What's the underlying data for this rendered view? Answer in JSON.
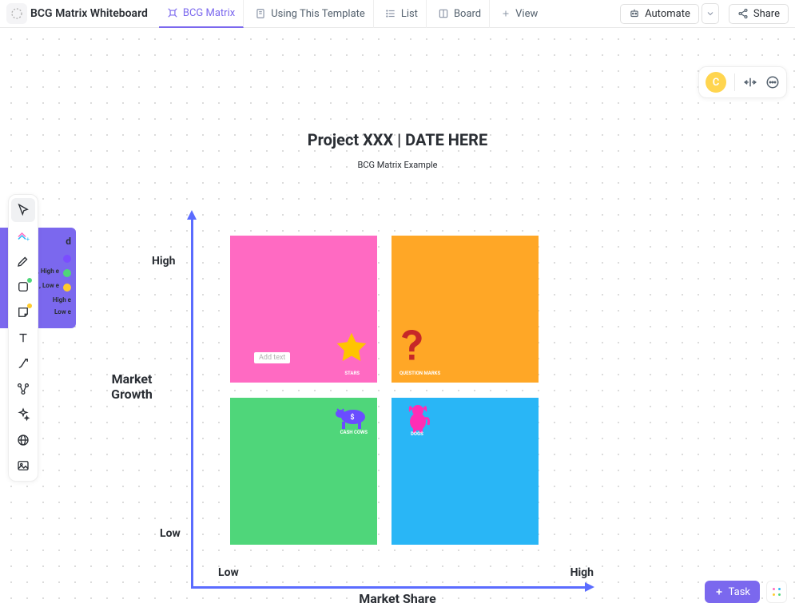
{
  "header": {
    "title": "BCG Matrix Whiteboard",
    "tabs": [
      {
        "label": "BCG Matrix",
        "active": true
      },
      {
        "label": "Using This Template",
        "active": false
      },
      {
        "label": "List",
        "active": false
      },
      {
        "label": "Board",
        "active": false
      }
    ],
    "view_button": "View",
    "automate_button": "Automate",
    "share_button": "Share"
  },
  "user": {
    "avatar_initial": "C"
  },
  "legend": {
    "title": "d",
    "items": [
      {
        "color": "#7B4DFF",
        "text": "..."
      },
      {
        "color": "#4FD67A",
        "text": ", High\ne"
      },
      {
        "color": "#FFCB2E",
        "text": ", Low\ne"
      },
      {
        "color": "#FFFFFF",
        "text": "High\ne"
      },
      {
        "color": "#FFFFFF",
        "text": "Low\ne"
      }
    ]
  },
  "chart_data": {
    "type": "matrix-2x2",
    "title": "Project XXX | DATE HERE",
    "subtitle": "BCG Matrix Example",
    "x_axis": {
      "label": "Market Share",
      "low": "Low",
      "high": "High"
    },
    "y_axis": {
      "label": "Market Growth",
      "low": "Low",
      "high": "High"
    },
    "quadrants": [
      {
        "id": "stars",
        "label": "STARS",
        "color": "#FF6AC2",
        "icon": "star-icon",
        "placeholder": "Add text"
      },
      {
        "id": "question-marks",
        "label": "QUESTION MARKS",
        "color": "#FFA726",
        "icon": "question-icon"
      },
      {
        "id": "cash-cows",
        "label": "CASH COWS",
        "color": "#4FD67A",
        "icon": "cow-icon"
      },
      {
        "id": "dogs",
        "label": "DOGS",
        "color": "#29B6F6",
        "icon": "dog-icon"
      }
    ]
  },
  "task_button": "Task"
}
